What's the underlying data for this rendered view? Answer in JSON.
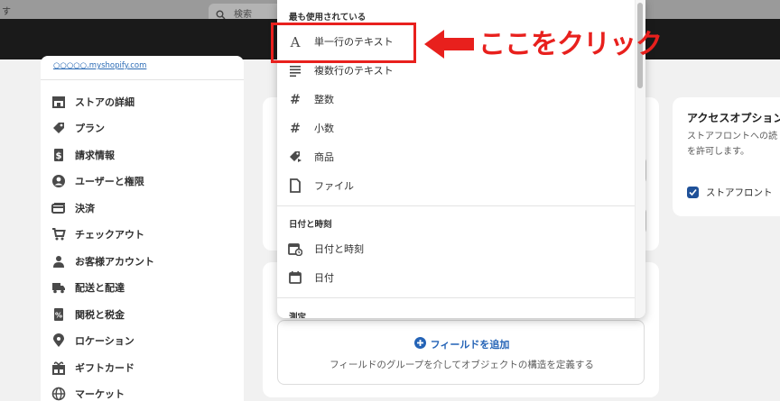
{
  "topbar": {
    "nav_fragment": "す",
    "search_placeholder": "検索"
  },
  "sidebar": {
    "store_url": "○○○○○.myshopify.com",
    "items": [
      {
        "label": "ストアの詳細",
        "icon": "store-icon"
      },
      {
        "label": "プラン",
        "icon": "plan-icon"
      },
      {
        "label": "請求情報",
        "icon": "billing-icon"
      },
      {
        "label": "ユーザーと権限",
        "icon": "user-icon"
      },
      {
        "label": "決済",
        "icon": "payment-card-icon"
      },
      {
        "label": "チェックアウト",
        "icon": "cart-icon"
      },
      {
        "label": "お客様アカウント",
        "icon": "customer-icon"
      },
      {
        "label": "配送と配達",
        "icon": "truck-icon"
      },
      {
        "label": "関税と税金",
        "icon": "tax-icon"
      },
      {
        "label": "ロケーション",
        "icon": "location-pin-icon"
      },
      {
        "label": "ギフトカード",
        "icon": "gift-icon"
      },
      {
        "label": "マーケット",
        "icon": "globe-icon"
      }
    ]
  },
  "dropdown": {
    "section_frequent": "最も使用されている",
    "frequent_items": [
      {
        "label": "単一行のテキスト",
        "icon": "text-letter-icon"
      },
      {
        "label": "複数行のテキスト",
        "icon": "paragraph-lines-icon"
      },
      {
        "label": "整数",
        "icon": "hash-icon"
      },
      {
        "label": "小数",
        "icon": "hash-icon"
      },
      {
        "label": "商品",
        "icon": "product-tag-icon"
      },
      {
        "label": "ファイル",
        "icon": "file-icon"
      }
    ],
    "section_datetime": "日付と時刻",
    "datetime_items": [
      {
        "label": "日付と時刻",
        "icon": "calendar-clock-icon"
      },
      {
        "label": "日付",
        "icon": "calendar-icon"
      }
    ],
    "section_measure": "測定"
  },
  "add_field": {
    "button_label": "フィールドを追加",
    "help_text": "フィールドのグループを介してオブジェクトの構造を定義する"
  },
  "access_card": {
    "title": "アクセスオプション",
    "desc_line1": "ストアフロントへの読",
    "desc_line2": "を許可します。",
    "checkbox_label": "ストアフロント",
    "checked": true
  },
  "annotation": {
    "callout_text": "ここをクリック",
    "color": "#e8201d"
  },
  "colors": {
    "link": "#2463b6",
    "checkbox": "#1f5199",
    "header_bg": "#1a1a1a"
  }
}
